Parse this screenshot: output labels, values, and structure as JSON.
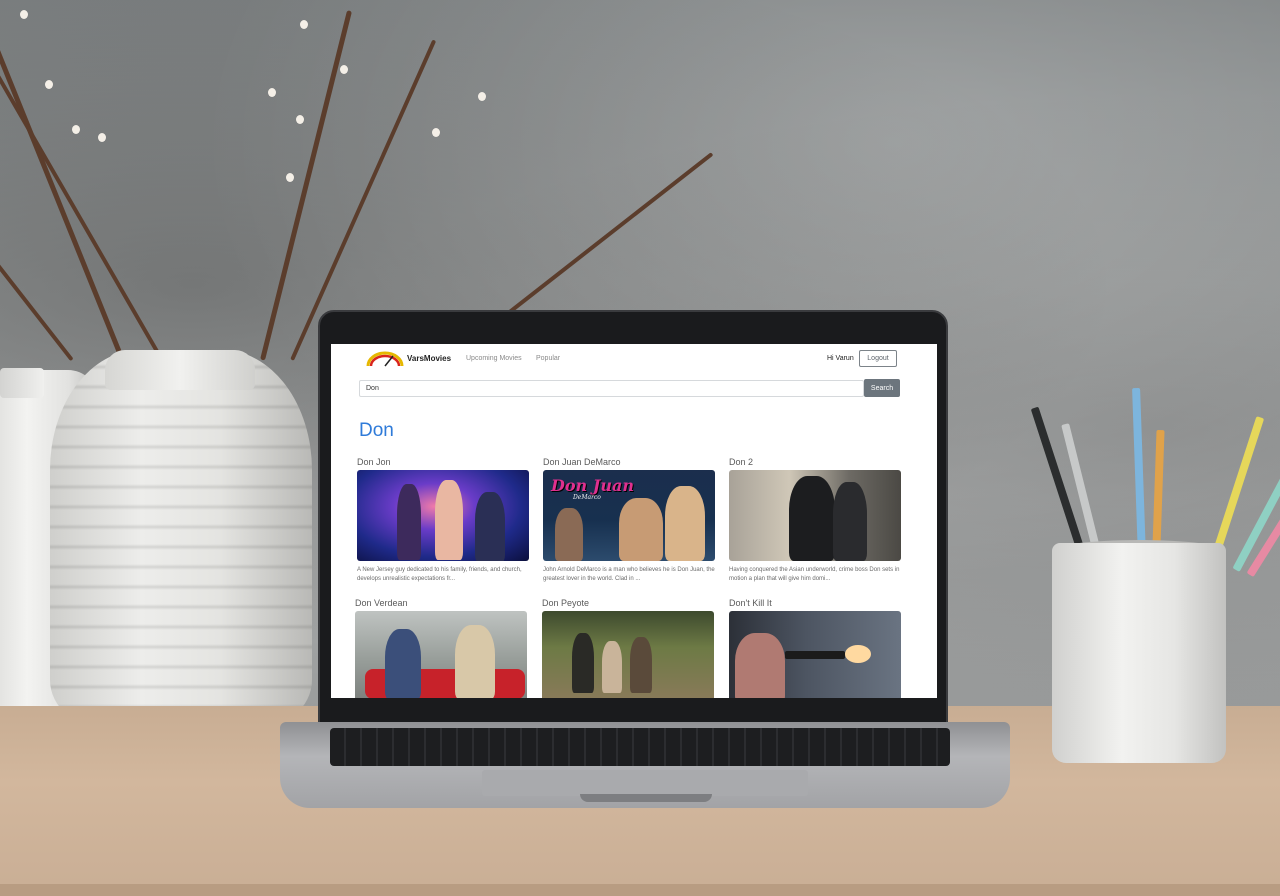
{
  "app": {
    "brand": "VarsMovies"
  },
  "nav": {
    "links": [
      "Upcoming Movies",
      "Popular"
    ],
    "greeting": "Hi Varun",
    "logout_label": "Logout"
  },
  "search": {
    "value": "Don",
    "button_label": "Search"
  },
  "results": {
    "heading": "Don",
    "movies": [
      {
        "title": "Don Jon",
        "description": "A New Jersey guy dedicated to his family, friends, and church, develops unrealistic expectations fr..."
      },
      {
        "title": "Don Juan DeMarco",
        "description": "John Arnold DeMarco is a man who believes he is Don Juan, the greatest lover in the world. Clad in ...",
        "poster_text": "Don Juan",
        "poster_subtext": "DeMarco"
      },
      {
        "title": "Don 2",
        "description": "Having conquered the Asian underworld, crime boss Don sets in motion a plan that will give him domi..."
      },
      {
        "title": "Don Verdean"
      },
      {
        "title": "Don Peyote"
      },
      {
        "title": "Don't Kill It"
      }
    ]
  },
  "colors": {
    "heading": "#2f7bd9",
    "search_button": "#6c757d"
  }
}
